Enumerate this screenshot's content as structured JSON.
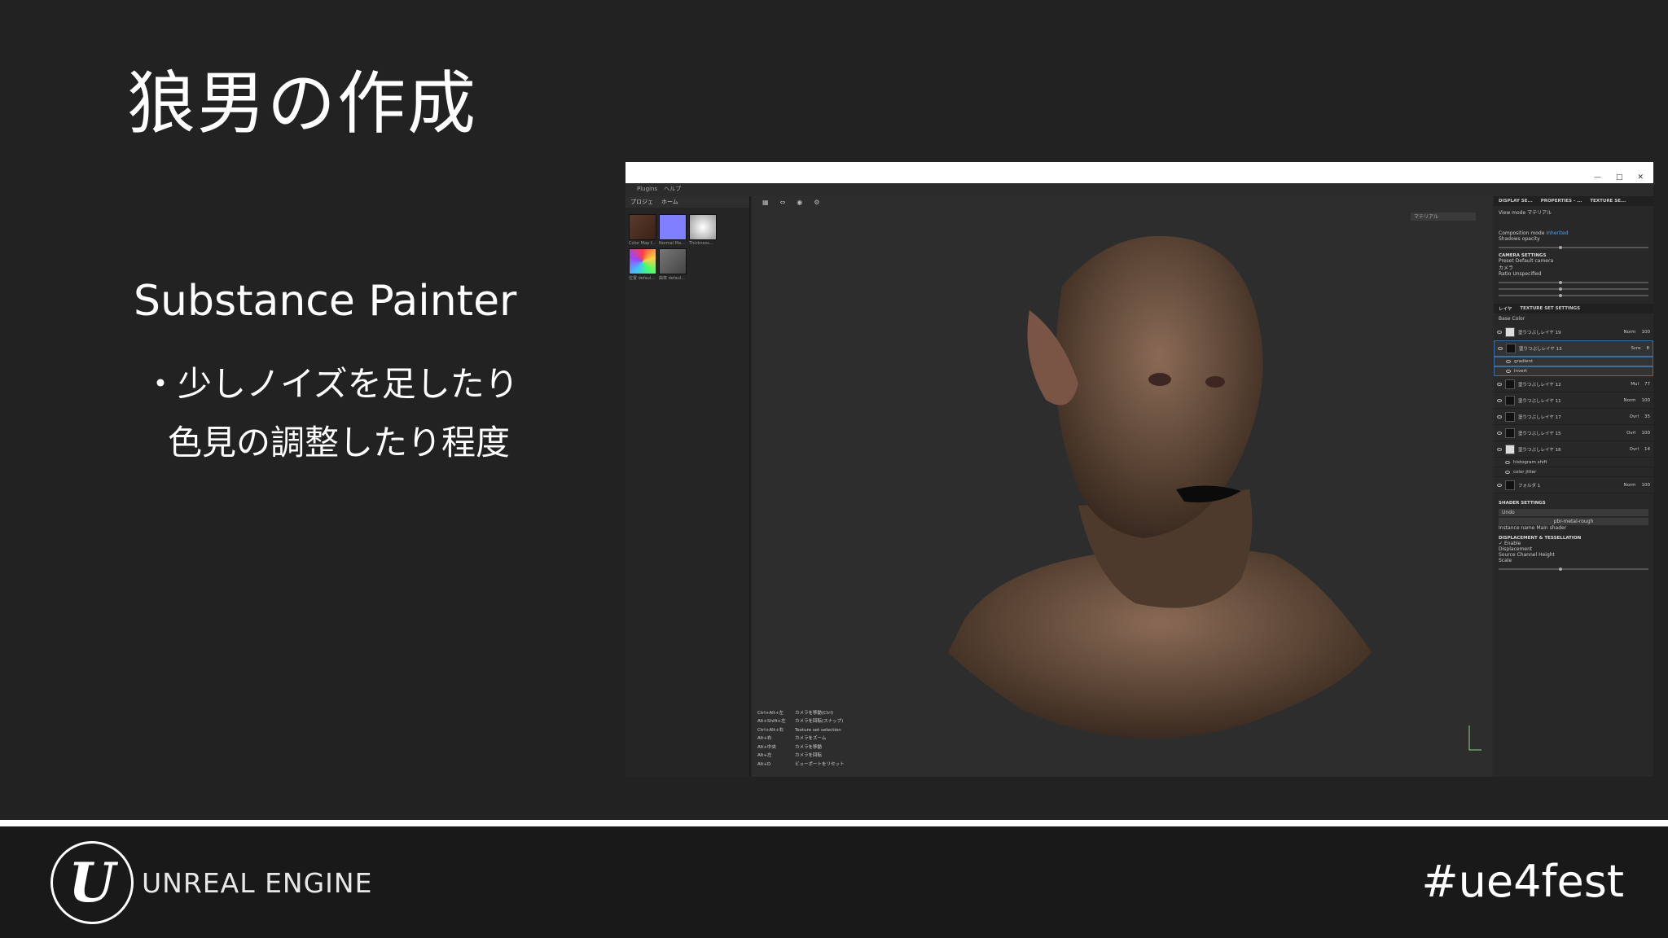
{
  "slide": {
    "title": "狼男の作成",
    "subtitle": "Substance Painter",
    "bullet_line1": "・少しノイズを足したり",
    "bullet_line2": "色見の調整したり程度"
  },
  "screenshot": {
    "menu": [
      "Plugins",
      "ヘルプ"
    ],
    "shelf_tabs": [
      "プロジェ",
      "ホーム"
    ],
    "thumbnails": [
      {
        "caption": "Color Map f...",
        "icon": "color-map"
      },
      {
        "caption": "Normal Ma...",
        "icon": "normal-map"
      },
      {
        "caption": "Thickness...",
        "icon": "thickness-map"
      },
      {
        "caption": "位置 defaul...",
        "icon": "position-map"
      },
      {
        "caption": "曲率 defaul...",
        "icon": "curvature-map"
      }
    ],
    "view_select": "マテリアル",
    "shortcuts": [
      {
        "key": "Ctrl+Alt+左",
        "action": "カメラを移動(Ctrl)"
      },
      {
        "key": "Alt+Shift+左",
        "action": "カメラを回転(スナップ)"
      },
      {
        "key": "Ctrl+Alt+右",
        "action": "Texture set selection"
      },
      {
        "key": "Alt+右",
        "action": "カメラをズーム"
      },
      {
        "key": "Alt+中央",
        "action": "カメラを移動"
      },
      {
        "key": "Alt+左",
        "action": "カメラを回転"
      },
      {
        "key": "Alt+D",
        "action": "ビューポートをリセット"
      }
    ],
    "right_tabs": [
      "DISPLAY SE...",
      "PROPERTIES - ...",
      "TEXTURE SE..."
    ],
    "display": {
      "view_mode_label": "View mode",
      "view_mode_value": "マテリアル",
      "composition_label": "Composition mode",
      "composition_value": "Inherited",
      "shadows_label": "Shadows opacity",
      "camera_head": "CAMERA SETTINGS",
      "preset_label": "Preset",
      "preset_value": "Default camera",
      "camera_sub": "カメラ",
      "ratio_label": "Ratio",
      "ratio_value": "Unspecified"
    },
    "layer_tabs": [
      "レイヤ",
      "TEXTURE SET SETTINGS"
    ],
    "base_color": "Base Color",
    "layers": [
      {
        "name": "塗りつぶしレイヤ 19",
        "blend": "Norm",
        "opacity": "100",
        "light": true,
        "sub": false,
        "selected": false
      },
      {
        "name": "塗りつぶしレイヤ 13",
        "blend": "Scre",
        "opacity": "8",
        "light": false,
        "sub": false,
        "selected": true
      },
      {
        "name": "gradient",
        "blend": "",
        "opacity": "",
        "light": false,
        "sub": true,
        "selected": true
      },
      {
        "name": "invert",
        "blend": "",
        "opacity": "",
        "light": false,
        "sub": true,
        "selected": true
      },
      {
        "name": "塗りつぶしレイヤ 12",
        "blend": "Mul",
        "opacity": "77",
        "light": false,
        "sub": false,
        "selected": false
      },
      {
        "name": "塗りつぶしレイヤ 11",
        "blend": "Norm",
        "opacity": "100",
        "light": false,
        "sub": false,
        "selected": false
      },
      {
        "name": "塗りつぶしレイヤ 17",
        "blend": "Ovrl",
        "opacity": "35",
        "light": false,
        "sub": false,
        "selected": false
      },
      {
        "name": "塗りつぶしレイヤ 15",
        "blend": "Ovrl",
        "opacity": "100",
        "light": false,
        "sub": false,
        "selected": false
      },
      {
        "name": "塗りつぶしレイヤ 16",
        "blend": "Ovrl",
        "opacity": "14",
        "light": true,
        "sub": false,
        "selected": false
      },
      {
        "name": "histogram shift",
        "blend": "",
        "opacity": "",
        "light": false,
        "sub": true,
        "selected": false
      },
      {
        "name": "color jitter",
        "blend": "",
        "opacity": "",
        "light": false,
        "sub": true,
        "selected": false
      },
      {
        "name": "フォルダ 1",
        "blend": "Norm",
        "opacity": "100",
        "light": false,
        "sub": false,
        "selected": false
      }
    ],
    "shader": {
      "head": "SHADER SETTINGS",
      "undo": "Undo",
      "button": "pbr-metal-rough",
      "instance_label": "Instance name",
      "instance_value": "Main shader",
      "disp_head": "DISPLACEMENT & TESSELLATION",
      "enable": "Enable",
      "displacement": "Displacement",
      "source_label": "Source Channel",
      "source_value": "Height",
      "scale_label": "Scale"
    }
  },
  "footer": {
    "brand": "UNREAL ENGINE",
    "hashtag": "#ue4fest"
  },
  "colors": {
    "background": "#222222",
    "footer": "#191919",
    "accent_selection": "#3a6ea5"
  }
}
